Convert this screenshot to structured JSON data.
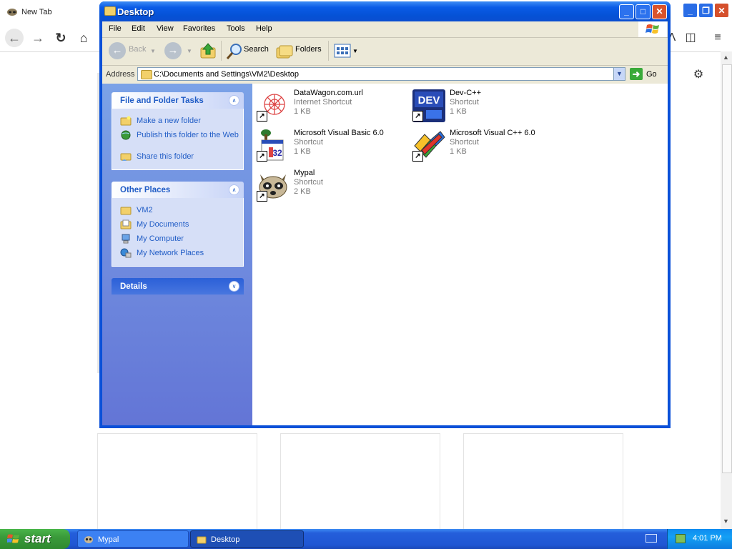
{
  "browser": {
    "tab_title": "New Tab"
  },
  "window": {
    "title": "Desktop"
  },
  "menu": [
    "File",
    "Edit",
    "View",
    "Favorites",
    "Tools",
    "Help"
  ],
  "toolbar": {
    "back": "Back",
    "search": "Search",
    "folders": "Folders"
  },
  "address": {
    "label": "Address",
    "value": "C:\\Documents and Settings\\VM2\\Desktop",
    "go": "Go"
  },
  "tasks": {
    "file_folder": {
      "title": "File and Folder Tasks",
      "items": [
        "Make a new folder",
        "Publish this folder to the Web",
        "Share this folder"
      ]
    },
    "other_places": {
      "title": "Other Places",
      "items": [
        "VM2",
        "My Documents",
        "My Computer",
        "My Network Places"
      ]
    },
    "details": {
      "title": "Details"
    }
  },
  "files": [
    {
      "name": "DataWagon.com.url",
      "type": "Internet Shortcut",
      "size": "1 KB"
    },
    {
      "name": "Dev-C++",
      "type": "Shortcut",
      "size": "1 KB"
    },
    {
      "name": "Microsoft Visual Basic 6.0",
      "type": "Shortcut",
      "size": "1 KB"
    },
    {
      "name": "Microsoft Visual C++ 6.0",
      "type": "Shortcut",
      "size": "1 KB"
    },
    {
      "name": "Mypal",
      "type": "Shortcut",
      "size": "2 KB"
    }
  ],
  "dev_icon_text": "DEV",
  "vb_icon_text": "32",
  "taskbar": {
    "start": "start",
    "items": [
      "Mypal",
      "Desktop"
    ],
    "clock": "4:01 PM"
  },
  "icons": {
    "back": "back-arrow-icon",
    "forward": "forward-arrow-icon",
    "up": "folder-up-icon",
    "search": "magnifier-icon",
    "folders": "folders-icon",
    "views": "views-icon"
  },
  "colors": {
    "xp_blue": "#0a50d8",
    "task_link": "#215dc6",
    "close_red": "#d9532b",
    "start_green": "#3a9a3a"
  }
}
